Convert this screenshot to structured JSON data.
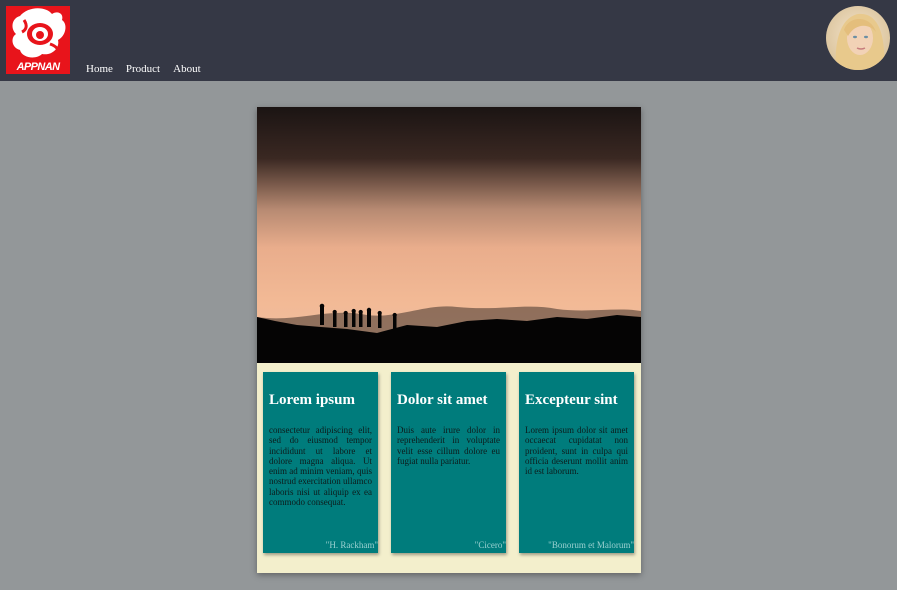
{
  "brand": {
    "logo_text": "APPNAN"
  },
  "nav": {
    "items": [
      "Home",
      "Product",
      "About"
    ]
  },
  "colors": {
    "topbar": "#353845",
    "page_background": "#939799",
    "card_background": "#f3efcc",
    "tile": "#007c7c",
    "logo": "#e8141b"
  },
  "icons": {
    "avatar": "user-avatar-photo"
  },
  "tiles": [
    {
      "title": "Lorem ipsum",
      "body": "consectetur adipiscing elit, sed do eiusmod tempor incididunt ut labore et dolore magna aliqua. Ut enim ad minim veniam, quis nostrud exercitation ullamco laboris nisi ut aliquip ex ea commodo consequat.",
      "cite": "\"H. Rackham\""
    },
    {
      "title": "Dolor sit amet",
      "body": "Duis aute irure dolor in reprehenderit in voluptate velit esse cillum dolore eu fugiat nulla pariatur.",
      "cite": "\"Cicero\""
    },
    {
      "title": "Excepteur sint",
      "body": "Lorem ipsum dolor sit amet occaecat cupidatat non proident, sunt in culpa qui officia deserunt mollit anim id est laborum.",
      "cite": "\"Bonorum et Malorum\""
    }
  ]
}
